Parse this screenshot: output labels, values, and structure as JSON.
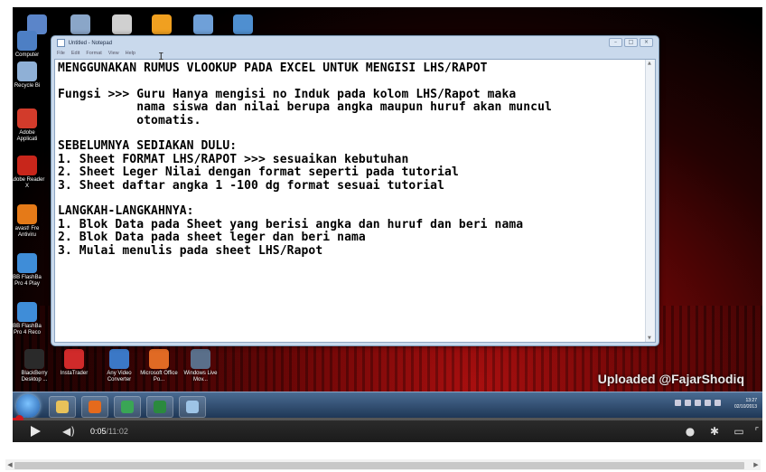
{
  "notepad": {
    "title": "Untitled - Notepad",
    "menu": [
      "File",
      "Edit",
      "Format",
      "View",
      "Help"
    ],
    "lines": [
      "MENGGUNAKAN RUMUS VLOOKUP PADA EXCEL UNTUK MENGISI LHS/RAPOT",
      "",
      "Fungsi >>> Guru Hanya mengisi no Induk pada kolom LHS/Rapot maka",
      "           nama siswa dan nilai berupa angka maupun huruf akan muncul",
      "           otomatis.",
      "",
      "SEBELUMNYA SEDIAKAN DULU:",
      "1. Sheet FORMAT LHS/RAPOT >>> sesuaikan kebutuhan",
      "2. Sheet Leger Nilai dengan format seperti pada tutorial",
      "3. Sheet daftar angka 1 -100 dg format sesuai tutorial",
      "",
      "LANGKAH-LANGKAHNYA:",
      "1. Blok Data pada Sheet yang berisi angka dan huruf dan beri nama",
      "2. Blok Data pada sheet leger dan beri nama",
      "3. Mulai menulis pada sheet LHS/Rapot"
    ]
  },
  "desktop_icons": {
    "left": [
      {
        "label": "Computer",
        "icon": "computer-icon",
        "color": "#4d7fc4"
      },
      {
        "label": "Recycle Bi",
        "icon": "recycle-bin-icon",
        "color": "#8fb0d6"
      },
      {
        "label": "Adobe Applicati",
        "icon": "adobe-icon",
        "color": "#d23b2b"
      },
      {
        "label": "Adobe Reader X",
        "icon": "adobe-reader-icon",
        "color": "#c8261b"
      },
      {
        "label": "avast! Fre Antiviru",
        "icon": "avast-icon",
        "color": "#e57a18"
      },
      {
        "label": "BB FlashBa Pro 4 Play",
        "icon": "flashback-play-icon",
        "color": "#3f8dd8"
      },
      {
        "label": "BB FlashBa Pro 4 Reco",
        "icon": "flashback-record-icon",
        "color": "#3f8dd8"
      }
    ],
    "top": [
      {
        "icon": "desktop-icon-1",
        "color": "#5b85c9"
      },
      {
        "icon": "desktop-icon-2",
        "color": "#8aa6c8"
      },
      {
        "icon": "desktop-icon-3",
        "color": "#d0d0d0"
      },
      {
        "icon": "desktop-icon-4",
        "color": "#f0a020"
      },
      {
        "icon": "desktop-icon-5",
        "color": "#6fa0d8"
      },
      {
        "icon": "desktop-icon-6",
        "color": "#4f8fd0"
      }
    ],
    "bottom": [
      {
        "label": "BlackBerry Desktop ...",
        "icon": "blackberry-icon",
        "color": "#2a2a2a"
      },
      {
        "label": "InstaTrader",
        "icon": "instatrader-icon",
        "color": "#d02a2a"
      },
      {
        "label": "Any Video Converter",
        "icon": "video-converter-icon",
        "color": "#3b78c6"
      },
      {
        "label": "Microsoft Office Po...",
        "icon": "office-icon",
        "color": "#e06a24"
      },
      {
        "label": "Windows Live Mov...",
        "icon": "movie-maker-icon",
        "color": "#5a6f8a"
      }
    ]
  },
  "watermark": "Uploaded @FajarShodiq",
  "taskbar": {
    "apps": [
      {
        "icon": "folder-icon",
        "color": "#e8c25a"
      },
      {
        "icon": "firefox-icon",
        "color": "#e56a1c"
      },
      {
        "icon": "chrome-icon",
        "color": "#3aa655"
      },
      {
        "icon": "excel-icon",
        "color": "#2b8a3e"
      },
      {
        "icon": "notepad-icon",
        "color": "#9ec4e6"
      }
    ],
    "clock_time": "13:27",
    "clock_date": "02/10/2013"
  },
  "player": {
    "current_time": "0:05",
    "separator": " / ",
    "duration": "11:02",
    "progress_fraction": 0.0075,
    "accent_color": "#cc181e"
  }
}
